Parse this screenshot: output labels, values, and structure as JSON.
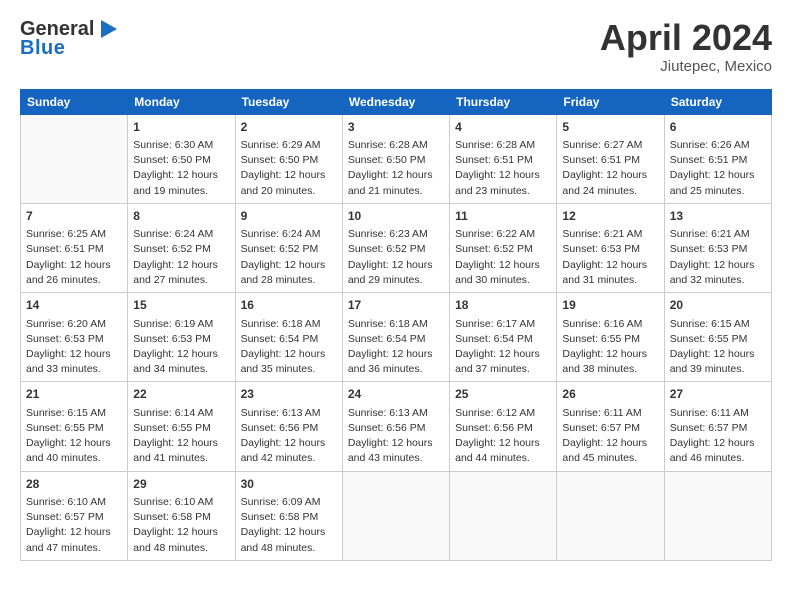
{
  "header": {
    "logo_general": "General",
    "logo_blue": "Blue",
    "month_title": "April 2024",
    "location": "Jiutepec, Mexico"
  },
  "days_of_week": [
    "Sunday",
    "Monday",
    "Tuesday",
    "Wednesday",
    "Thursday",
    "Friday",
    "Saturday"
  ],
  "weeks": [
    [
      {
        "day": "",
        "sunrise": "",
        "sunset": "",
        "daylight": ""
      },
      {
        "day": "1",
        "sunrise": "Sunrise: 6:30 AM",
        "sunset": "Sunset: 6:50 PM",
        "daylight": "Daylight: 12 hours and 19 minutes."
      },
      {
        "day": "2",
        "sunrise": "Sunrise: 6:29 AM",
        "sunset": "Sunset: 6:50 PM",
        "daylight": "Daylight: 12 hours and 20 minutes."
      },
      {
        "day": "3",
        "sunrise": "Sunrise: 6:28 AM",
        "sunset": "Sunset: 6:50 PM",
        "daylight": "Daylight: 12 hours and 21 minutes."
      },
      {
        "day": "4",
        "sunrise": "Sunrise: 6:28 AM",
        "sunset": "Sunset: 6:51 PM",
        "daylight": "Daylight: 12 hours and 23 minutes."
      },
      {
        "day": "5",
        "sunrise": "Sunrise: 6:27 AM",
        "sunset": "Sunset: 6:51 PM",
        "daylight": "Daylight: 12 hours and 24 minutes."
      },
      {
        "day": "6",
        "sunrise": "Sunrise: 6:26 AM",
        "sunset": "Sunset: 6:51 PM",
        "daylight": "Daylight: 12 hours and 25 minutes."
      }
    ],
    [
      {
        "day": "7",
        "sunrise": "Sunrise: 6:25 AM",
        "sunset": "Sunset: 6:51 PM",
        "daylight": "Daylight: 12 hours and 26 minutes."
      },
      {
        "day": "8",
        "sunrise": "Sunrise: 6:24 AM",
        "sunset": "Sunset: 6:52 PM",
        "daylight": "Daylight: 12 hours and 27 minutes."
      },
      {
        "day": "9",
        "sunrise": "Sunrise: 6:24 AM",
        "sunset": "Sunset: 6:52 PM",
        "daylight": "Daylight: 12 hours and 28 minutes."
      },
      {
        "day": "10",
        "sunrise": "Sunrise: 6:23 AM",
        "sunset": "Sunset: 6:52 PM",
        "daylight": "Daylight: 12 hours and 29 minutes."
      },
      {
        "day": "11",
        "sunrise": "Sunrise: 6:22 AM",
        "sunset": "Sunset: 6:52 PM",
        "daylight": "Daylight: 12 hours and 30 minutes."
      },
      {
        "day": "12",
        "sunrise": "Sunrise: 6:21 AM",
        "sunset": "Sunset: 6:53 PM",
        "daylight": "Daylight: 12 hours and 31 minutes."
      },
      {
        "day": "13",
        "sunrise": "Sunrise: 6:21 AM",
        "sunset": "Sunset: 6:53 PM",
        "daylight": "Daylight: 12 hours and 32 minutes."
      }
    ],
    [
      {
        "day": "14",
        "sunrise": "Sunrise: 6:20 AM",
        "sunset": "Sunset: 6:53 PM",
        "daylight": "Daylight: 12 hours and 33 minutes."
      },
      {
        "day": "15",
        "sunrise": "Sunrise: 6:19 AM",
        "sunset": "Sunset: 6:53 PM",
        "daylight": "Daylight: 12 hours and 34 minutes."
      },
      {
        "day": "16",
        "sunrise": "Sunrise: 6:18 AM",
        "sunset": "Sunset: 6:54 PM",
        "daylight": "Daylight: 12 hours and 35 minutes."
      },
      {
        "day": "17",
        "sunrise": "Sunrise: 6:18 AM",
        "sunset": "Sunset: 6:54 PM",
        "daylight": "Daylight: 12 hours and 36 minutes."
      },
      {
        "day": "18",
        "sunrise": "Sunrise: 6:17 AM",
        "sunset": "Sunset: 6:54 PM",
        "daylight": "Daylight: 12 hours and 37 minutes."
      },
      {
        "day": "19",
        "sunrise": "Sunrise: 6:16 AM",
        "sunset": "Sunset: 6:55 PM",
        "daylight": "Daylight: 12 hours and 38 minutes."
      },
      {
        "day": "20",
        "sunrise": "Sunrise: 6:15 AM",
        "sunset": "Sunset: 6:55 PM",
        "daylight": "Daylight: 12 hours and 39 minutes."
      }
    ],
    [
      {
        "day": "21",
        "sunrise": "Sunrise: 6:15 AM",
        "sunset": "Sunset: 6:55 PM",
        "daylight": "Daylight: 12 hours and 40 minutes."
      },
      {
        "day": "22",
        "sunrise": "Sunrise: 6:14 AM",
        "sunset": "Sunset: 6:55 PM",
        "daylight": "Daylight: 12 hours and 41 minutes."
      },
      {
        "day": "23",
        "sunrise": "Sunrise: 6:13 AM",
        "sunset": "Sunset: 6:56 PM",
        "daylight": "Daylight: 12 hours and 42 minutes."
      },
      {
        "day": "24",
        "sunrise": "Sunrise: 6:13 AM",
        "sunset": "Sunset: 6:56 PM",
        "daylight": "Daylight: 12 hours and 43 minutes."
      },
      {
        "day": "25",
        "sunrise": "Sunrise: 6:12 AM",
        "sunset": "Sunset: 6:56 PM",
        "daylight": "Daylight: 12 hours and 44 minutes."
      },
      {
        "day": "26",
        "sunrise": "Sunrise: 6:11 AM",
        "sunset": "Sunset: 6:57 PM",
        "daylight": "Daylight: 12 hours and 45 minutes."
      },
      {
        "day": "27",
        "sunrise": "Sunrise: 6:11 AM",
        "sunset": "Sunset: 6:57 PM",
        "daylight": "Daylight: 12 hours and 46 minutes."
      }
    ],
    [
      {
        "day": "28",
        "sunrise": "Sunrise: 6:10 AM",
        "sunset": "Sunset: 6:57 PM",
        "daylight": "Daylight: 12 hours and 47 minutes."
      },
      {
        "day": "29",
        "sunrise": "Sunrise: 6:10 AM",
        "sunset": "Sunset: 6:58 PM",
        "daylight": "Daylight: 12 hours and 48 minutes."
      },
      {
        "day": "30",
        "sunrise": "Sunrise: 6:09 AM",
        "sunset": "Sunset: 6:58 PM",
        "daylight": "Daylight: 12 hours and 48 minutes."
      },
      {
        "day": "",
        "sunrise": "",
        "sunset": "",
        "daylight": ""
      },
      {
        "day": "",
        "sunrise": "",
        "sunset": "",
        "daylight": ""
      },
      {
        "day": "",
        "sunrise": "",
        "sunset": "",
        "daylight": ""
      },
      {
        "day": "",
        "sunrise": "",
        "sunset": "",
        "daylight": ""
      }
    ]
  ]
}
